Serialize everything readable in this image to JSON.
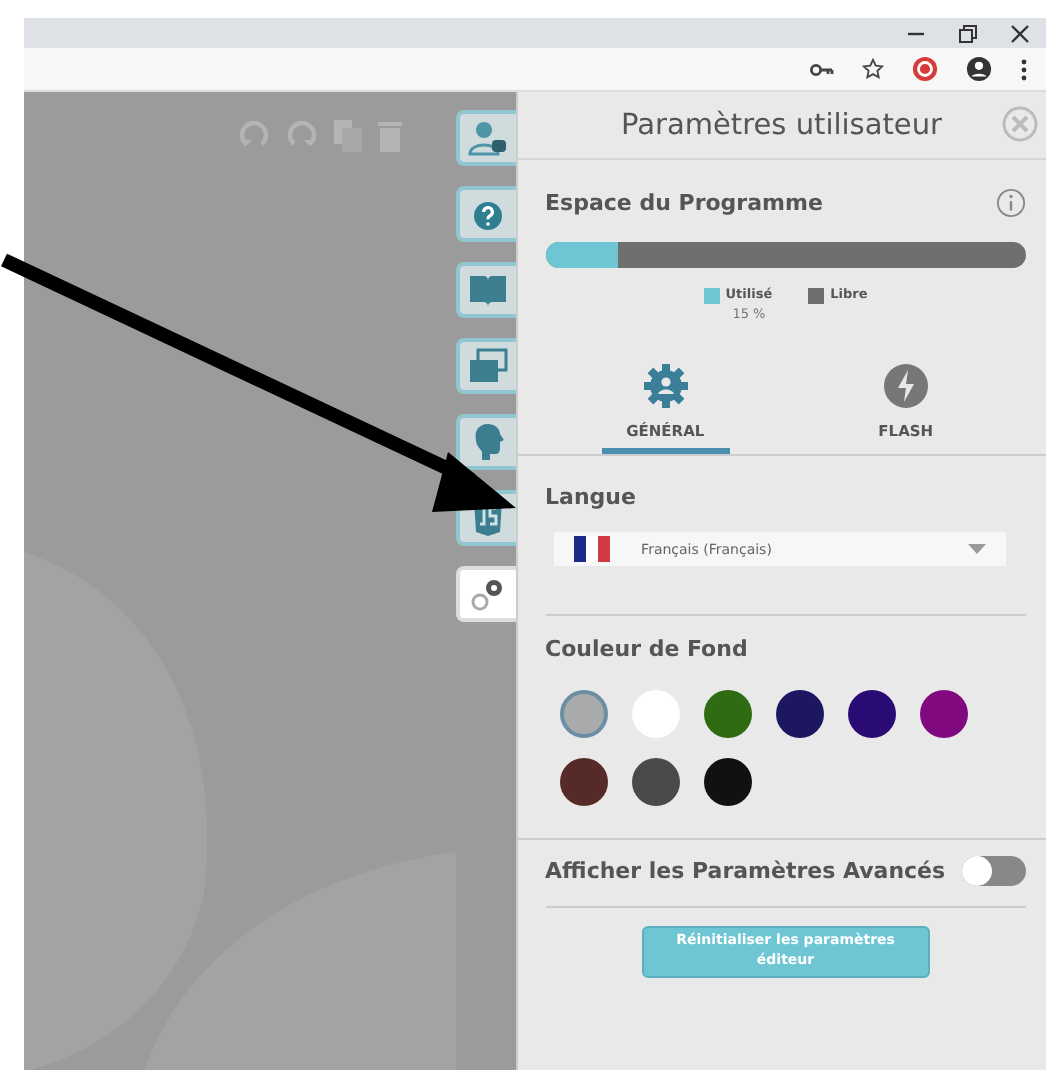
{
  "sidebar": {
    "items": [
      {
        "kind": "user",
        "selected": false
      },
      {
        "kind": "help",
        "selected": false
      },
      {
        "kind": "book",
        "selected": false
      },
      {
        "kind": "windows",
        "selected": false
      },
      {
        "kind": "brain",
        "selected": false
      },
      {
        "kind": "code",
        "selected": false
      },
      {
        "kind": "settings",
        "selected": true
      }
    ]
  },
  "panel": {
    "title": "Paramètres utilisateur",
    "storage": {
      "heading": "Espace du Programme",
      "level": 0.15,
      "legend": [
        {
          "label": "Utilisé",
          "value": "15 %",
          "color": "#6ec6d4"
        },
        {
          "label": "Libre",
          "color": "#6f6f6f"
        }
      ]
    },
    "tabs": [
      {
        "label": "GÉNÉRAL",
        "kind": "gear",
        "selected": true
      },
      {
        "label": "FLASH",
        "kind": "flash",
        "selected": false
      }
    ],
    "language": {
      "heading": "Langue",
      "value": "Français (Français)"
    },
    "background": {
      "heading": "Couleur de Fond",
      "swatches": [
        {
          "color": "#a9aaab",
          "selected": true
        },
        {
          "color": "#ffffff",
          "selected": false
        },
        {
          "color": "#2e6b12",
          "selected": false
        },
        {
          "color": "#1c1760",
          "selected": false
        },
        {
          "color": "#2a0a73",
          "selected": false
        },
        {
          "color": "#80097f",
          "selected": false
        },
        {
          "color": "#552a28",
          "selected": false
        },
        {
          "color": "#4a4a4a",
          "selected": false
        },
        {
          "color": "#111111",
          "selected": false
        }
      ]
    },
    "advanced": {
      "label": "Afficher les Paramètres Avancés",
      "on": false
    },
    "reset_button": "Réinitialiser les paramètres éditeur"
  }
}
